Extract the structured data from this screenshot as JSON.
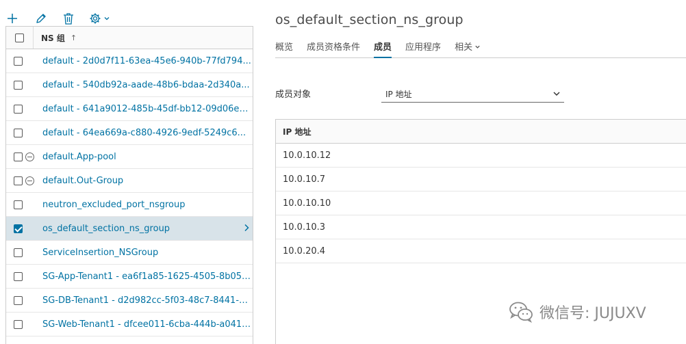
{
  "toolbar": {
    "add_icon": "plus-icon",
    "edit_icon": "pencil-icon",
    "delete_icon": "trash-icon",
    "settings_icon": "gear-icon"
  },
  "list": {
    "header_label": "NS 组",
    "sort": "ascending",
    "rows": [
      {
        "label": "default - 2d0d7f11-63ea-45e6-940b-77fd794...",
        "status": "",
        "checked": false,
        "selected": false
      },
      {
        "label": "default - 540db92a-aade-48b6-bdaa-2d340a...",
        "status": "",
        "checked": false,
        "selected": false
      },
      {
        "label": "default - 641a9012-485b-45df-bb12-09d06e1...",
        "status": "",
        "checked": false,
        "selected": false
      },
      {
        "label": "default - 64ea669a-c880-4926-9edf-5249c6...",
        "status": "",
        "checked": false,
        "selected": false
      },
      {
        "label": "default.App-pool",
        "status": "minus-circle-icon",
        "checked": false,
        "selected": false
      },
      {
        "label": "default.Out-Group",
        "status": "minus-circle-icon",
        "checked": false,
        "selected": false
      },
      {
        "label": "neutron_excluded_port_nsgroup",
        "status": "",
        "checked": false,
        "selected": false
      },
      {
        "label": "os_default_section_ns_group",
        "status": "",
        "checked": true,
        "selected": true
      },
      {
        "label": "ServiceInsertion_NSGroup",
        "status": "",
        "checked": false,
        "selected": false
      },
      {
        "label": "SG-App-Tenant1 - ea6f1a85-1625-4505-8b05-...",
        "status": "",
        "checked": false,
        "selected": false
      },
      {
        "label": "SG-DB-Tenant1 - d2d982cc-5f03-48c7-8441-5...",
        "status": "",
        "checked": false,
        "selected": false
      },
      {
        "label": "SG-Web-Tenant1 - dfcee011-6cba-444b-a041-...",
        "status": "",
        "checked": false,
        "selected": false
      }
    ]
  },
  "detail": {
    "title": "os_default_section_ns_group",
    "tabs": [
      {
        "label": "概览",
        "active": false
      },
      {
        "label": "成员资格条件",
        "active": false
      },
      {
        "label": "成员",
        "active": true
      },
      {
        "label": "应用程序",
        "active": false
      },
      {
        "label": "相关",
        "active": false,
        "dropdown": true
      }
    ],
    "member_object_label": "成员对象",
    "member_object_value": "IP 地址",
    "grid": {
      "column": "IP 地址",
      "rows": [
        "10.0.10.12",
        "10.0.10.7",
        "10.0.10.10",
        "10.0.10.3",
        "10.0.20.4"
      ]
    }
  },
  "watermark": {
    "text": "微信号: JUJUXV"
  },
  "colors": {
    "link": "#0072a3",
    "selected_row": "#d8e3e9",
    "border": "#cccccc"
  }
}
